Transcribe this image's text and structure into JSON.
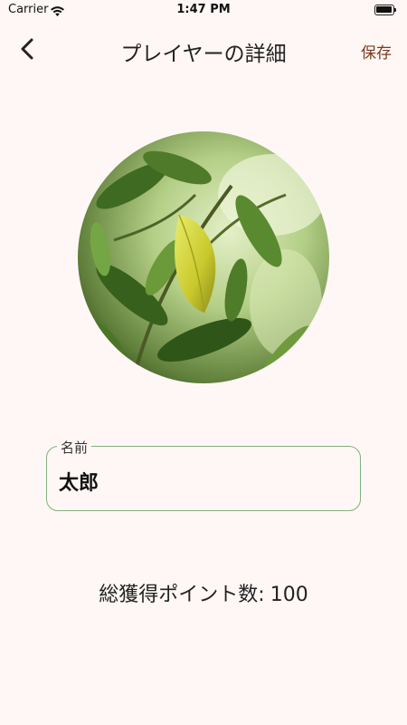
{
  "status_bar": {
    "carrier": "Carrier",
    "time": "1:47 PM"
  },
  "nav": {
    "title": "プレイヤーの詳細",
    "save_label": "保存",
    "back_icon": "chevron-left-icon"
  },
  "avatar": {
    "description_icon": "player-photo"
  },
  "name_field": {
    "label": "名前",
    "value": "太郎"
  },
  "points": {
    "label": "総獲得ポイント数:",
    "value": "100"
  },
  "colors": {
    "background": "#fff7f5",
    "accent": "#7b3a1f",
    "field_border": "#7fb27f"
  }
}
